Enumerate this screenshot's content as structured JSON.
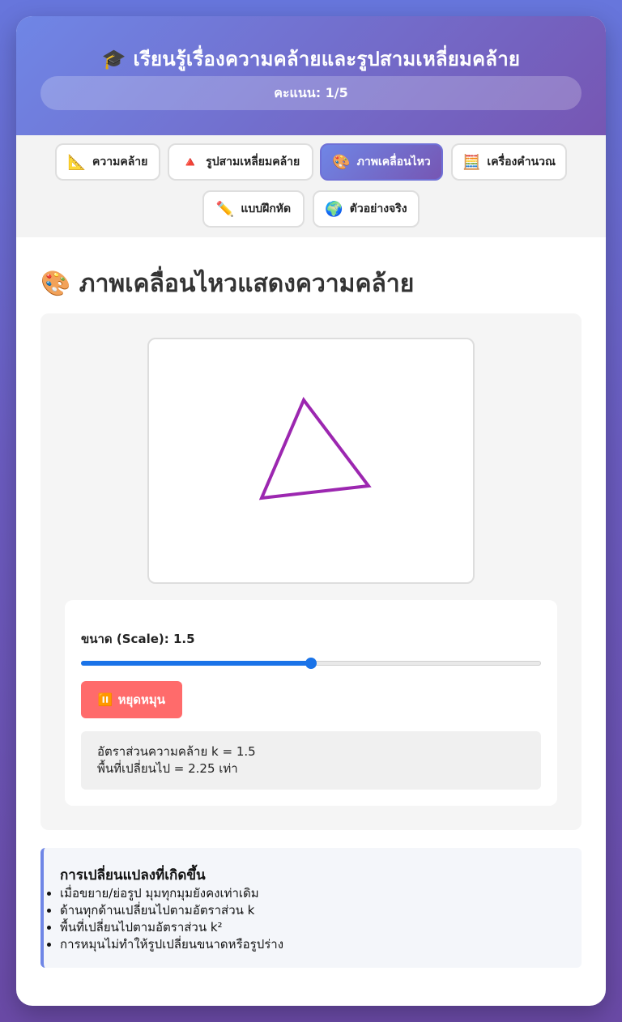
{
  "header": {
    "title": "🎓 เรียนรู้เรื่องความคล้ายและรูปสามเหลี่ยมคล้าย",
    "score": "คะแนน: 1/5"
  },
  "tabs": [
    {
      "icon": "📐",
      "label": "ความคล้าย",
      "active": false
    },
    {
      "icon": "🔺",
      "label": "รูปสามเหลี่ยมคล้าย",
      "active": false
    },
    {
      "icon": "🎨",
      "label": "ภาพเคลื่อนไหว",
      "active": true
    },
    {
      "icon": "🧮",
      "label": "เครื่องคำนวณ",
      "active": false
    },
    {
      "icon": "✏️",
      "label": "แบบฝึกหัด",
      "active": false
    },
    {
      "icon": "🌍",
      "label": "ตัวอย่างจริง",
      "active": false
    }
  ],
  "section": {
    "title": "🎨 ภาพเคลื่อนไหวแสดงความคล้าย"
  },
  "shape": {
    "stroke_color": "#9c27b0"
  },
  "controls": {
    "scale_label": "ขนาด (Scale): 1.5",
    "slider": {
      "min": 0.5,
      "max": 2.5,
      "value": 1.5
    },
    "pause_icon": "⏸️",
    "pause_label": "หยุดหมุน",
    "ratio_text": "อัตราส่วนความคล้าย k = 1.5",
    "area_text": "พื้นที่เปลี่ยนไป = 2.25 เท่า"
  },
  "changes": {
    "title": "การเปลี่ยนแปลงที่เกิดขึ้น",
    "items": [
      "เมื่อขยาย/ย่อรูป มุมทุกมุมยังคงเท่าเดิม",
      "ด้านทุกด้านเปลี่ยนไปตามอัตราส่วน k",
      "พื้นที่เปลี่ยนไปตามอัตราส่วน k²",
      "การหมุนไม่ทำให้รูปเปลี่ยนขนาดหรือรูปร่าง"
    ]
  },
  "colors": {
    "accent": "#6f86e6",
    "slider": "#1a73e8",
    "pause_button": "#ff6b6b"
  }
}
